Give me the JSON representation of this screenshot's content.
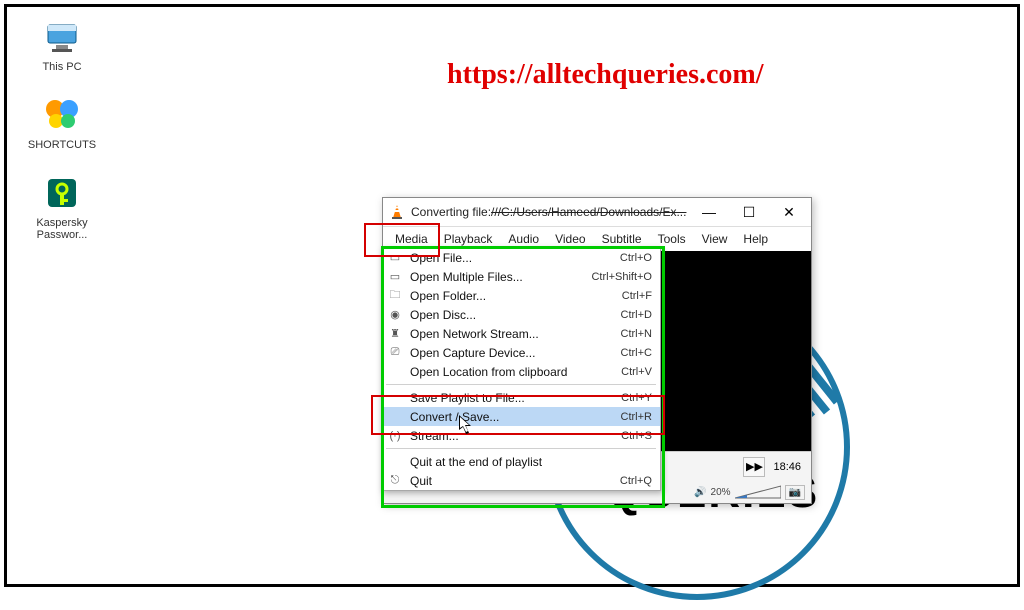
{
  "watermark_url": "https://alltechqueries.com/",
  "desktop": {
    "icons": [
      {
        "name": "this-pc",
        "label": "This PC"
      },
      {
        "name": "shortcuts",
        "label": "SHORTCUTS"
      },
      {
        "name": "kaspersky",
        "label": "Kaspersky Passwor..."
      }
    ]
  },
  "vlc": {
    "title_prefix": "Converting file:",
    "title_hidden": "///C:/Users/Hameed/Downloads/Ex...",
    "window_controls": {
      "min": "—",
      "max": "☐",
      "close": "✕"
    },
    "menubar": [
      "Media",
      "Playback",
      "Audio",
      "Video",
      "Subtitle",
      "Tools",
      "View",
      "Help"
    ],
    "time": "18:46",
    "volume_pct": "20%",
    "media_menu": [
      {
        "icon": "▭",
        "label": "Open File...",
        "shortcut": "Ctrl+O"
      },
      {
        "icon": "▭",
        "label": "Open Multiple Files...",
        "shortcut": "Ctrl+Shift+O"
      },
      {
        "icon": "🗀",
        "label": "Open Folder...",
        "shortcut": "Ctrl+F"
      },
      {
        "icon": "◉",
        "label": "Open Disc...",
        "shortcut": "Ctrl+D"
      },
      {
        "icon": "♜",
        "label": "Open Network Stream...",
        "shortcut": "Ctrl+N"
      },
      {
        "icon": "⎚",
        "label": "Open Capture Device...",
        "shortcut": "Ctrl+C"
      },
      {
        "icon": "",
        "label": "Open Location from clipboard",
        "shortcut": "Ctrl+V"
      },
      {
        "sep": true
      },
      {
        "icon": "",
        "label": "Save Playlist to File...",
        "shortcut": "Ctrl+Y"
      },
      {
        "icon": "",
        "label": "Convert / Save...",
        "shortcut": "Ctrl+R",
        "selected": true
      },
      {
        "icon": "(·)",
        "label": "Stream...",
        "shortcut": "Ctrl+S"
      },
      {
        "sep": true
      },
      {
        "icon": "",
        "label": "Quit at the end of playlist",
        "shortcut": ""
      },
      {
        "icon": "⎋",
        "label": "Quit",
        "shortcut": "Ctrl+Q"
      }
    ]
  },
  "bg_logo_text": "QUERIES"
}
